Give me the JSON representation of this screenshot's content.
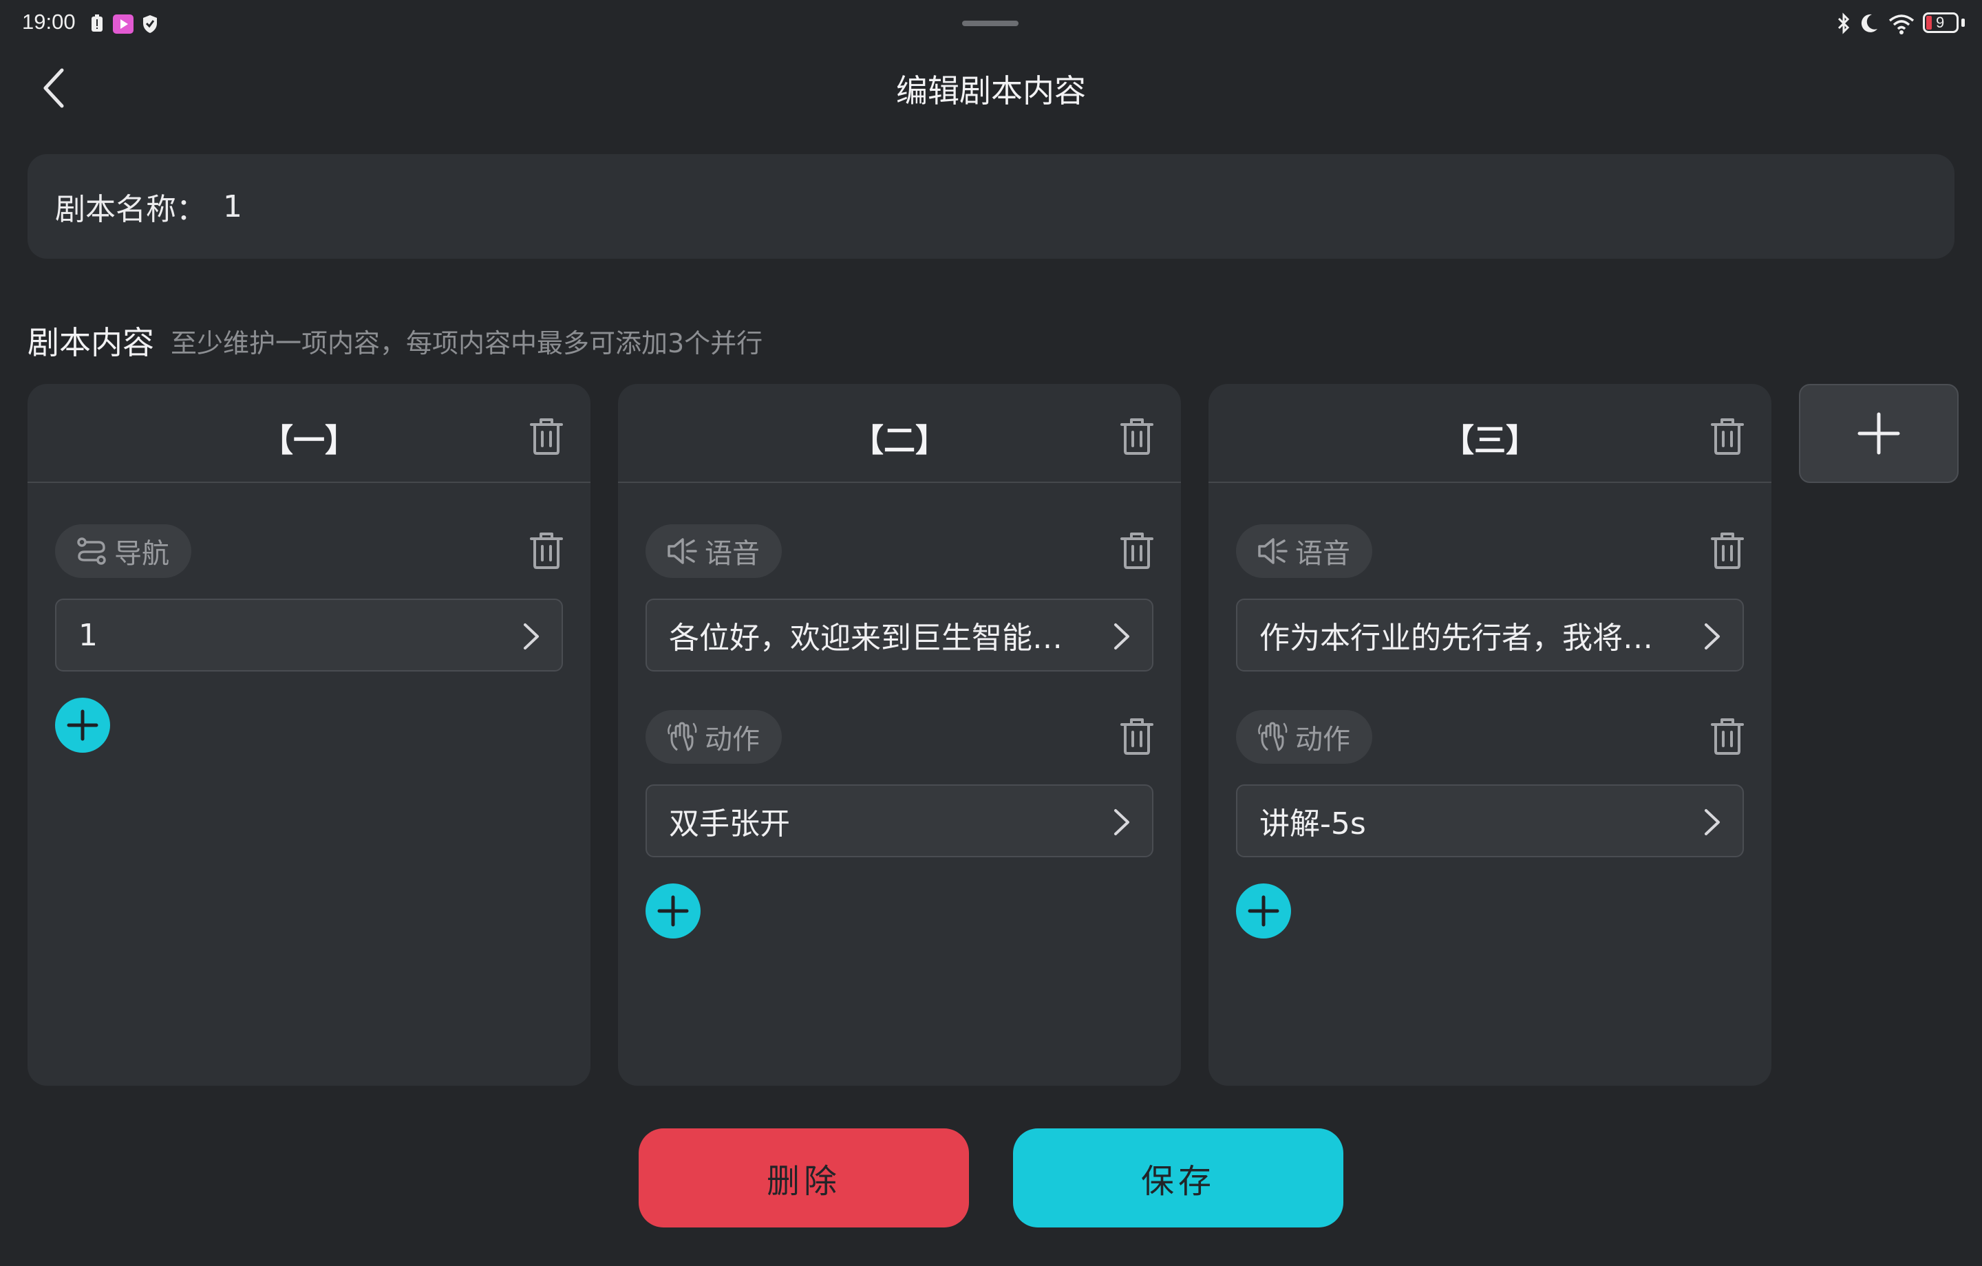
{
  "status": {
    "time": "19:00",
    "battery": "9"
  },
  "header": {
    "title": "编辑剧本内容"
  },
  "script_name": {
    "label": "剧本名称：",
    "value": "1"
  },
  "section": {
    "title": "剧本内容",
    "hint": "至少维护一项内容，每项内容中最多可添加3个并行"
  },
  "columns": [
    {
      "title": "【一】",
      "items": [
        {
          "type_label": "导航",
          "icon": "navigation-icon",
          "value": "1"
        }
      ]
    },
    {
      "title": "【二】",
      "items": [
        {
          "type_label": "语音",
          "icon": "speaker-icon",
          "value": "各位好，欢迎来到巨生智能与…"
        },
        {
          "type_label": "动作",
          "icon": "gesture-hand-icon",
          "value": "双手张开"
        }
      ]
    },
    {
      "title": "【三】",
      "items": [
        {
          "type_label": "语音",
          "icon": "speaker-icon",
          "value": "作为本行业的先行者，我将负…"
        },
        {
          "type_label": "动作",
          "icon": "gesture-hand-icon",
          "value": "讲解-5s"
        }
      ]
    }
  ],
  "actions": {
    "delete_label": "删除",
    "save_label": "保存"
  },
  "colors": {
    "accent": "#18c9da",
    "danger": "#e5404e",
    "background": "#242629",
    "card": "#2e3135"
  }
}
